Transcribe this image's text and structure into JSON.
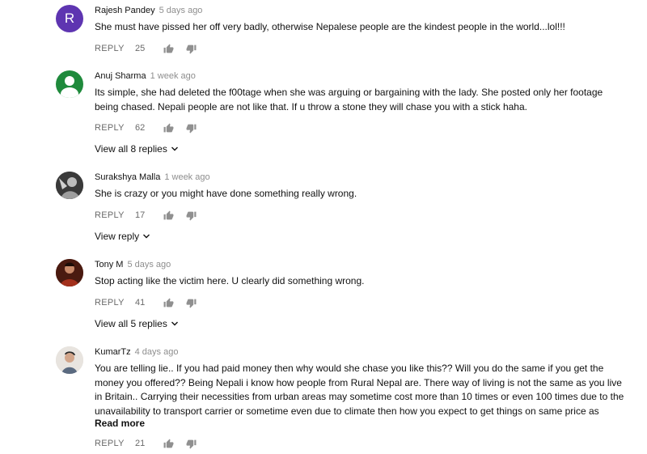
{
  "reply_label": "REPLY",
  "comments": [
    {
      "author": "Rajesh Pandey",
      "time": "5 days ago",
      "avatar_letter": "R",
      "avatar_color": "#5e35b1",
      "text": "She must have pissed her off very badly, otherwise Nepalese people are the kindest people in the world...lol!!!",
      "likes": "25"
    },
    {
      "author": "Anuj Sharma",
      "time": "1 week ago",
      "avatar_color": "#1f8a3c",
      "text": "Its simple, she had deleted the f00tage when she was arguing or bargaining with the lady. She posted only her footage being chased. Nepali people are not like that. If u throw a stone they will chase you with a stick haha.",
      "likes": "62",
      "view_replies": "View all 8 replies"
    },
    {
      "author": "Surakshya Malla",
      "time": "1 week ago",
      "avatar_color": "#2d2d2d",
      "text": "She is crazy or you might have done something really wrong.",
      "likes": "17",
      "view_replies": "View reply"
    },
    {
      "author": "Tony M",
      "time": "5 days ago",
      "avatar_color": "#6b1f12",
      "text": "Stop acting like the victim here. U clearly did something wrong.",
      "likes": "41",
      "view_replies": "View all 5 replies"
    },
    {
      "author": "KumarTz",
      "time": "4 days ago",
      "avatar_color": "#d9d4cf",
      "text": "You are telling lie.. If you had paid  money then why would she chase you like this?? Will you do the same if you get the money you offered?? Being Nepali i know how people from Rural Nepal are. There way of living is not the same as you live in Britain..   Carrying their necessities from urban areas may sometime cost more than 10 times or even 100 times due to the unavailability to transport carrier or sometime even due to climate then how you expect to get things on same price as",
      "read_more": "Read more",
      "likes": "21"
    }
  ]
}
